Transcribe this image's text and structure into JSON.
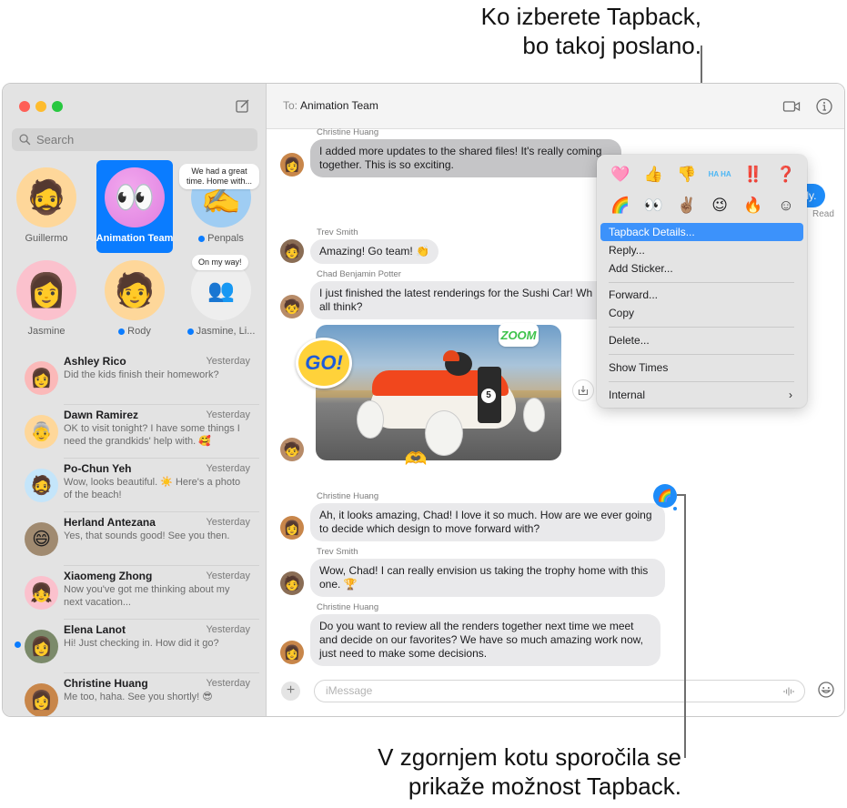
{
  "callouts": {
    "top_line1": "Ko izberete Tapback,",
    "top_line2": "bo takoj poslano.",
    "bottom_line1": "V zgornjem kotu sporočila se",
    "bottom_line2": "prikaže možnost Tapback."
  },
  "sidebar": {
    "search_placeholder": "Search",
    "pinned": [
      {
        "name": "Guillermo",
        "emoji": "🧔",
        "unread": false
      },
      {
        "name": "Animation Team",
        "emoji": "👀",
        "unread": false,
        "selected": true
      },
      {
        "name": "Penpals",
        "emoji": "✍️",
        "unread": true,
        "preview_bubble": "We had a great time. Home with..."
      },
      {
        "name": "Jasmine",
        "emoji": "👩",
        "unread": false
      },
      {
        "name": "Rody",
        "emoji": "🧑",
        "unread": true
      },
      {
        "name": "Jasmine, Li...",
        "emoji": "👥",
        "unread": true,
        "preview_bubble": "On my way!"
      }
    ],
    "conversations": [
      {
        "name": "Ashley Rico",
        "time": "Yesterday",
        "preview": "Did the kids finish their homework?",
        "emoji": "👩",
        "unread": false
      },
      {
        "name": "Dawn Ramirez",
        "time": "Yesterday",
        "preview": "OK to visit tonight? I have some things I need the grandkids' help with. 🥰",
        "emoji": "👵",
        "unread": false
      },
      {
        "name": "Po-Chun Yeh",
        "time": "Yesterday",
        "preview": "Wow, looks beautiful. ☀️ Here's a photo of the beach!",
        "emoji": "🧔",
        "unread": false
      },
      {
        "name": "Herland Antezana",
        "time": "Yesterday",
        "preview": "Yes, that sounds good! See you then.",
        "emoji": "😄",
        "unread": false
      },
      {
        "name": "Xiaomeng Zhong",
        "time": "Yesterday",
        "preview": "Now you've got me thinking about my next vacation...",
        "emoji": "👧",
        "unread": false
      },
      {
        "name": "Elena Lanot",
        "time": "Yesterday",
        "preview": "Hi! Just checking in. How did it go?",
        "emoji": "👩",
        "unread": true
      },
      {
        "name": "Christine Huang",
        "time": "Yesterday",
        "preview": "Me too, haha. See you shortly! 😎",
        "emoji": "👩",
        "unread": false
      }
    ]
  },
  "header": {
    "to_label": "To:",
    "recipient": "Animation Team"
  },
  "messages": [
    {
      "sender": "Christine Huang",
      "text": "I added more updates to the shared files! It's really coming together. This is so exciting."
    },
    {
      "sender": "Trev Smith",
      "text": "Amazing! Go team! 👏"
    },
    {
      "sender": "Chad Benjamin Potter",
      "text": "I just finished the latest renderings for the Sushi Car! What do you all think?",
      "visible_text": "I just finished the latest renderings for the Sushi Car! Wh all think?"
    },
    {
      "sender": "Christine Huang",
      "text": "Ah, it looks amazing, Chad! I love it so much. How are we ever going to decide which design to move forward with?",
      "tapback": "🌈"
    },
    {
      "sender": "Trev Smith",
      "text": "Wow, Chad! I can really envision us taking the trophy home with this one. 🏆"
    },
    {
      "sender": "Christine Huang",
      "text": "Do you want to review all the renders together next time we meet and decide on our favorites? We have so much amazing work now, just need to make some decisions."
    }
  ],
  "outgoing": {
    "partial_text": "tly.",
    "status": "Read"
  },
  "photo": {
    "number": "5",
    "sticker_go": "GO!",
    "sticker_zoom": "ZOOM",
    "sticker_heart": "🫶"
  },
  "composer": {
    "placeholder": "iMessage",
    "plus": "+"
  },
  "context_menu": {
    "tapbacks_row1": [
      "🩷",
      "👍",
      "👎",
      "HA HA",
      "‼️",
      "❓"
    ],
    "tapbacks_row2": [
      "🌈",
      "👀",
      "✌🏽",
      "😉",
      "🔥",
      "☺"
    ],
    "items": [
      {
        "label": "Tapback Details...",
        "active": true
      },
      {
        "label": "Reply..."
      },
      {
        "label": "Add Sticker..."
      },
      {
        "label": "Forward..."
      },
      {
        "label": "Copy"
      },
      {
        "label": "Delete..."
      },
      {
        "label": "Show Times"
      },
      {
        "label": "Internal",
        "submenu": true
      }
    ],
    "submenu_chevron": "›"
  },
  "colors": {
    "accent": "#0a7cff",
    "menu_highlight": "#3c92fb",
    "outgoing_bubble": "#1e8cf9",
    "incoming_bubble": "#e9e9eb"
  }
}
